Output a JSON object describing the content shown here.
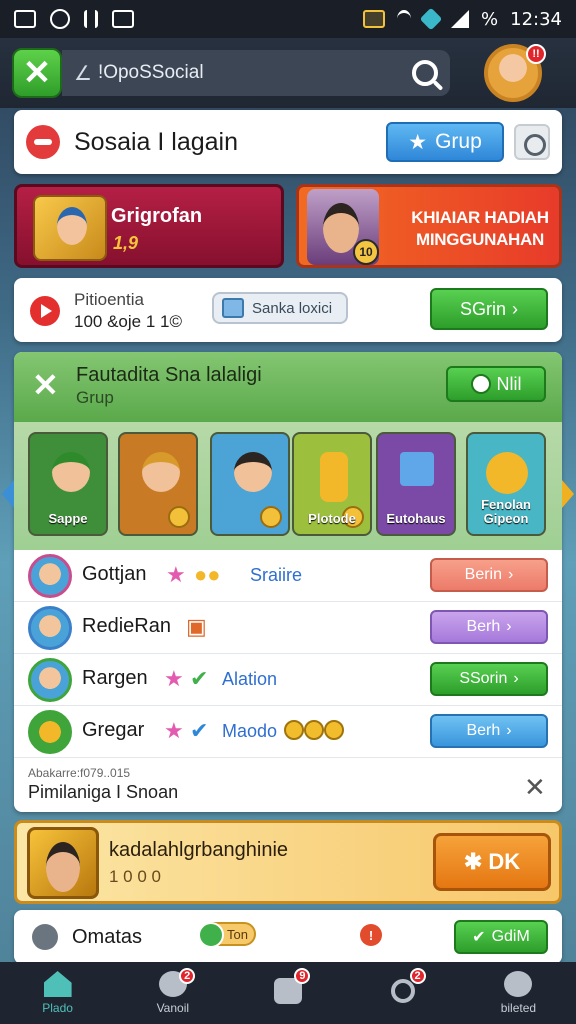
{
  "status_bar": {
    "time": "12:34",
    "battery": "%"
  },
  "top_bar": {
    "search_value": "!OpoSSocial",
    "avatar_badge": "!!"
  },
  "header": {
    "title": "Sosaia I lagain",
    "grup_label": "Grup"
  },
  "promos": {
    "left": {
      "title": "Grigrofan",
      "sub": "1,9"
    },
    "right": {
      "title": "KHIAIAR HADIAH MINGGUNAHAN",
      "coin": "10"
    }
  },
  "info": {
    "name": "Pitioentia",
    "count": "100 &oje 1 1©",
    "chip": "Sanka loxici",
    "action": "SGrin"
  },
  "panel": {
    "title": "Fautadita Sna lalaligi",
    "subtitle": "Grup",
    "action": "Nlil",
    "tiles": [
      {
        "caption": "Sappe",
        "color": "#3f8f3a"
      },
      {
        "caption": "",
        "color": "#c97a24"
      },
      {
        "caption": "",
        "color": "#4ba3d6"
      },
      {
        "caption": "Plotode",
        "color": "#9cbf3e"
      },
      {
        "caption": "Eutohaus",
        "color": "#7a4aa6"
      },
      {
        "caption": "Fenolan Gipeon",
        "color": "#48b6c4"
      }
    ],
    "rows": [
      {
        "name": "Gottjan",
        "tag": "Sraiire",
        "button": "Berin",
        "style": "salmon"
      },
      {
        "name": "RedieRan",
        "tag": "",
        "button": "Berh",
        "style": "violet"
      },
      {
        "name": "Rargen",
        "tag": "Alation",
        "button": "SSorin",
        "style": "grn"
      },
      {
        "name": "Gregar",
        "tag": "Maodo",
        "button": "Berh",
        "style": "blu"
      }
    ],
    "footer_small": "Abakarre:f079..015",
    "footer_label": "Pimilaniga I Snoan"
  },
  "reward": {
    "text": "kadalahlgrbanghinie",
    "sub": "1 0 0 0",
    "ok": "DK"
  },
  "bottom": {
    "label": "Omatas",
    "pill": "Ton",
    "button": "GdiM"
  },
  "nav": [
    {
      "label": "Plado",
      "badge": ""
    },
    {
      "label": "Vanoil",
      "badge": "2"
    },
    {
      "label": "",
      "badge": "9"
    },
    {
      "label": "",
      "badge": "2"
    },
    {
      "label": "bileted",
      "badge": ""
    }
  ],
  "colors": {
    "accent_green": "#2d9e2b",
    "header_red": "#b51f45",
    "promo_orange": "#f26b21"
  }
}
